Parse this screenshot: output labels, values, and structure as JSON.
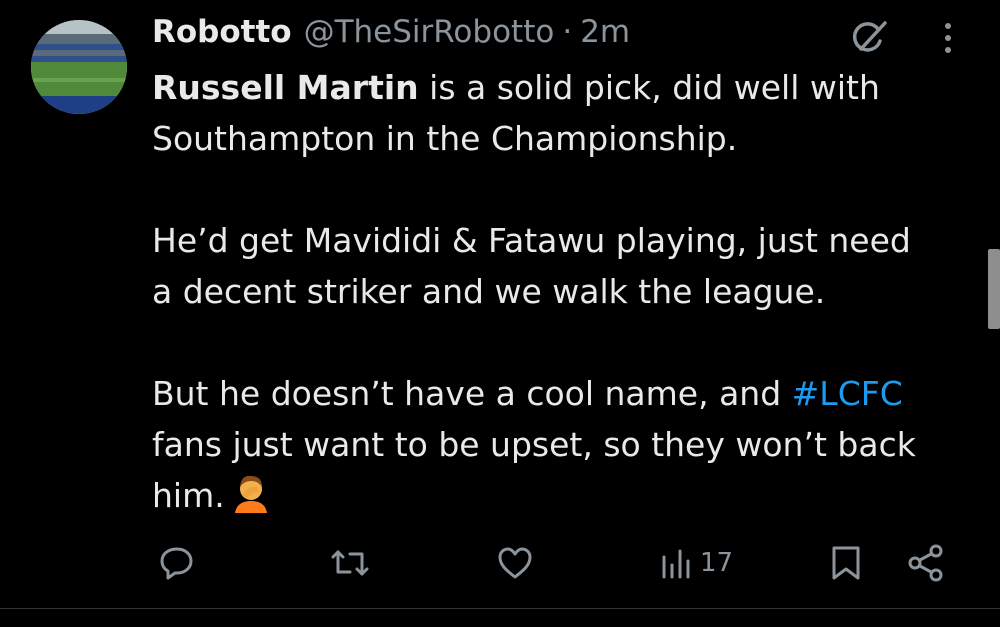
{
  "post": {
    "author": {
      "name": "Robotto",
      "handle": "@TheSirRobotto",
      "separator": "·",
      "time": "2m"
    },
    "paragraphs": {
      "p1": {
        "mention": "Russell Martin",
        "rest_line1": " is a solid pick, did well with",
        "rest_line2": "Southampton in the Championship."
      },
      "p2": {
        "line1": "He’d get Mavididi & Fatawu playing, just need",
        "line2": "a decent striker and we walk the league."
      },
      "p3": {
        "before_hashtag": "But he doesn’t have a cool name, and ",
        "hashtag": "#LCFC",
        "line2": "fans just want to be upset, so they won’t back",
        "line3": "him."
      }
    },
    "emoji": "person-facepalming",
    "actions": {
      "views": "17"
    },
    "colors": {
      "background": "#000000",
      "text": "#e7e9ea",
      "muted": "#8b949b",
      "hashtag": "#1d9bf0"
    },
    "icons": [
      "grok-icon",
      "more-icon",
      "reply-icon",
      "repost-icon",
      "like-icon",
      "views-icon",
      "bookmark-icon",
      "share-icon"
    ]
  }
}
